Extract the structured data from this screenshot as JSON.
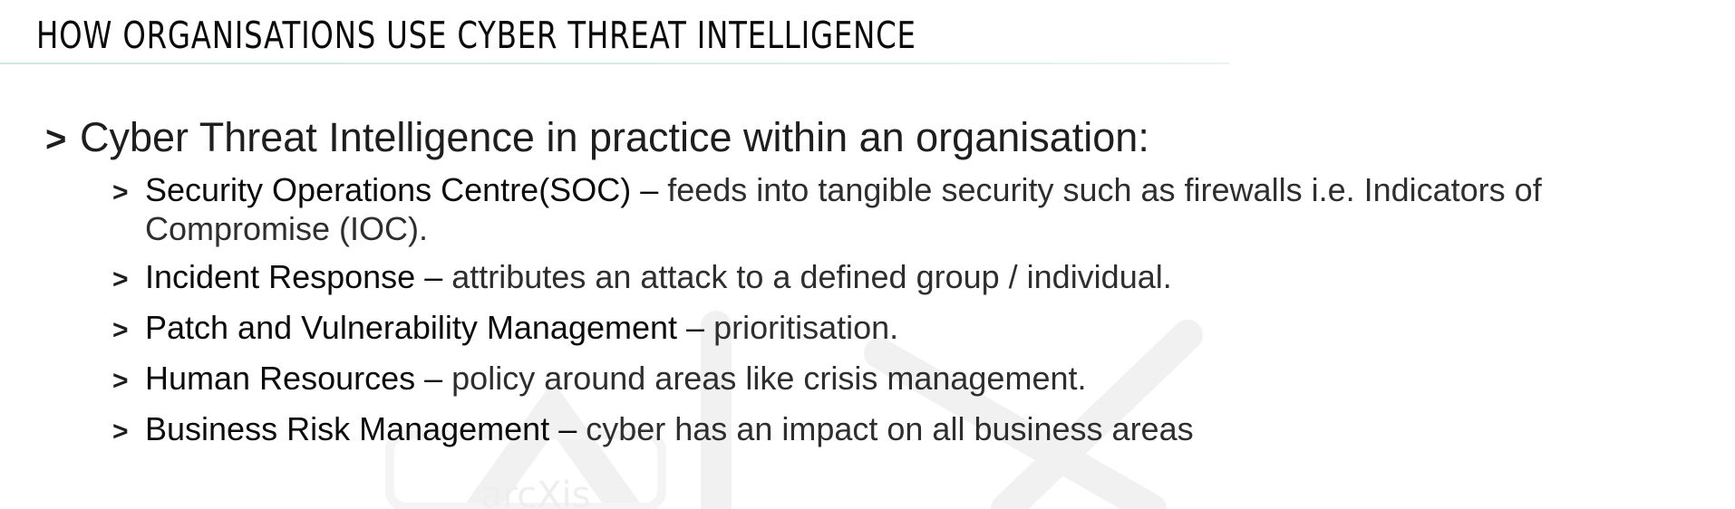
{
  "title": "HOW ORGANISATIONS USE CYBER THREAT INTELLIGENCE",
  "main_bullet": {
    "marker": ">",
    "text": "Cyber Threat Intelligence in practice within an organisation:"
  },
  "sub_bullets": [
    {
      "marker": ">",
      "term": "Security Operations Centre(SOC)",
      "separator": " – ",
      "description": "feeds into tangible security such as firewalls i.e. Indicators of Compromise (IOC)."
    },
    {
      "marker": ">",
      "term": "Incident Response",
      "separator": " – ",
      "description": "attributes an attack to a defined group / individual."
    },
    {
      "marker": ">",
      "term": "Patch and Vulnerability Management",
      "separator": " – ",
      "description": "prioritisation."
    },
    {
      "marker": ">",
      "term": "Human Resources",
      "separator": " – ",
      "description": "policy around areas like crisis management."
    },
    {
      "marker": ">",
      "term": "Business Risk Management",
      "separator": " – ",
      "description": "cyber has an impact on all business areas"
    }
  ],
  "watermark_logo": {
    "text": "arcXis",
    "color": "#f2f2f2"
  }
}
